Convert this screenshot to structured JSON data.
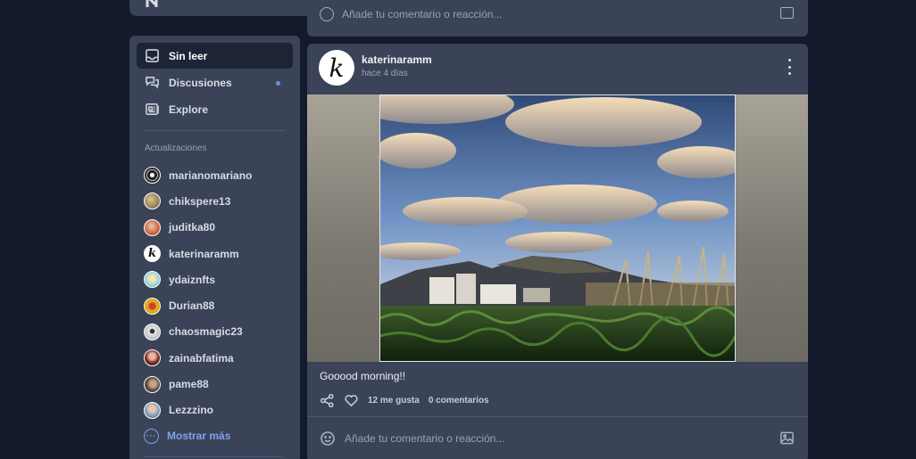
{
  "sidebar": {
    "nav": [
      {
        "label": "Sin leer",
        "icon": "inbox-icon",
        "active": true
      },
      {
        "label": "Discusiones",
        "icon": "chat-bubbles-icon",
        "unread_dot": true
      },
      {
        "label": "Explore",
        "icon": "newspaper-icon"
      }
    ],
    "section_title": "Actualizaciones",
    "users": [
      {
        "name": "marianomariano",
        "avatar_color": "#222222"
      },
      {
        "name": "chikspere13",
        "avatar_color": "#8a7a52"
      },
      {
        "name": "juditka80",
        "avatar_color": "#c9653f"
      },
      {
        "name": "katerinaramm",
        "avatar_color": "#ffffff"
      },
      {
        "name": "ydaiznfts",
        "avatar_color": "#9fd6e0"
      },
      {
        "name": "Durian88",
        "avatar_color": "#e0b420"
      },
      {
        "name": "chaosmagic23",
        "avatar_color": "#e8e8e8"
      },
      {
        "name": "zainabfatima",
        "avatar_color": "#7a2a22"
      },
      {
        "name": "pame88",
        "avatar_color": "#5a4a40"
      },
      {
        "name": "Lezzzino",
        "avatar_color": "#8aa0b8"
      }
    ],
    "show_more": "Mostrar más"
  },
  "prev_post": {
    "comment_placeholder": "Añade tu comentario o reacción..."
  },
  "post": {
    "author": "katerinaramm",
    "avatar_letter": "k",
    "time": "hace 4 días",
    "text": "Gooood morning!!",
    "likes": "12 me gusta",
    "comments": "0 comentarios",
    "comment_placeholder": "Añade tu comentario o reacción...",
    "image_alt": "sunset-landscape-photo"
  },
  "colors": {
    "background": "#131a2b",
    "card": "#3a4358",
    "accent": "#7ea3ec",
    "active_nav": "#1d2436"
  }
}
